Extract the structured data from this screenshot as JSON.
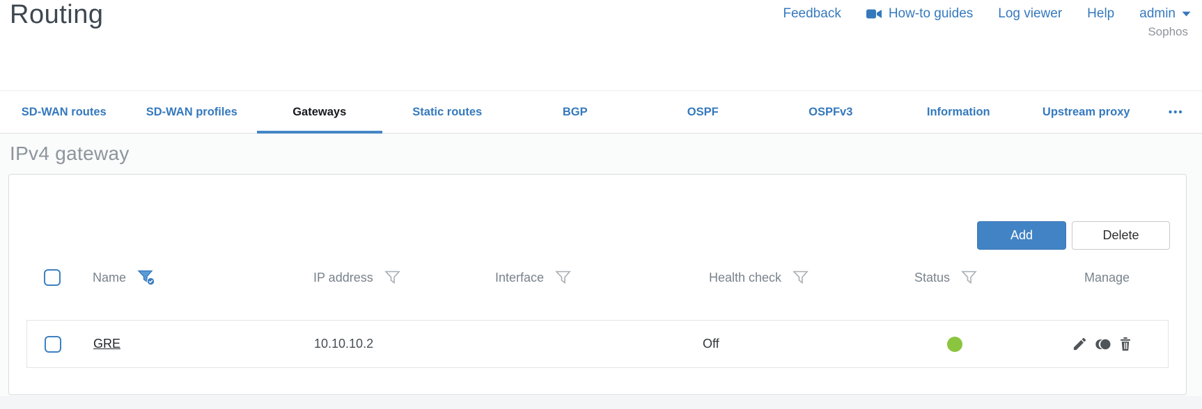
{
  "page": {
    "title": "Routing",
    "brand": "Sophos"
  },
  "top_nav": {
    "feedback": "Feedback",
    "howto_guides": "How-to guides",
    "log_viewer": "Log viewer",
    "help": "Help",
    "user": "admin"
  },
  "tabs": {
    "items": [
      {
        "label": "SD-WAN routes",
        "active": false
      },
      {
        "label": "SD-WAN profiles",
        "active": false
      },
      {
        "label": "Gateways",
        "active": true
      },
      {
        "label": "Static routes",
        "active": false
      },
      {
        "label": "BGP",
        "active": false
      },
      {
        "label": "OSPF",
        "active": false
      },
      {
        "label": "OSPFv3",
        "active": false
      },
      {
        "label": "Information",
        "active": false
      },
      {
        "label": "Upstream proxy",
        "active": false
      }
    ],
    "overflow_label": "•••"
  },
  "section": {
    "heading": "IPv4 gateway"
  },
  "toolbar": {
    "add": "Add",
    "delete": "Delete"
  },
  "table": {
    "columns": [
      {
        "label": "Name",
        "filter": "active"
      },
      {
        "label": "IP address",
        "filter": "inactive"
      },
      {
        "label": "Interface",
        "filter": "inactive"
      },
      {
        "label": "Health check",
        "filter": "inactive"
      },
      {
        "label": "Status",
        "filter": "inactive"
      },
      {
        "label": "Manage",
        "filter": "none"
      }
    ],
    "rows": [
      {
        "name": "GRE",
        "ip_address": "10.10.10.2",
        "interface": "",
        "health_check": "Off",
        "status": "up",
        "manage_icons": [
          "edit-icon",
          "clone-icon",
          "delete-icon"
        ]
      }
    ]
  },
  "colors": {
    "link_blue": "#3579bd",
    "button_blue": "#4183c4",
    "active_tab_underline": "#4586c4",
    "status_green": "#8bc53f"
  }
}
